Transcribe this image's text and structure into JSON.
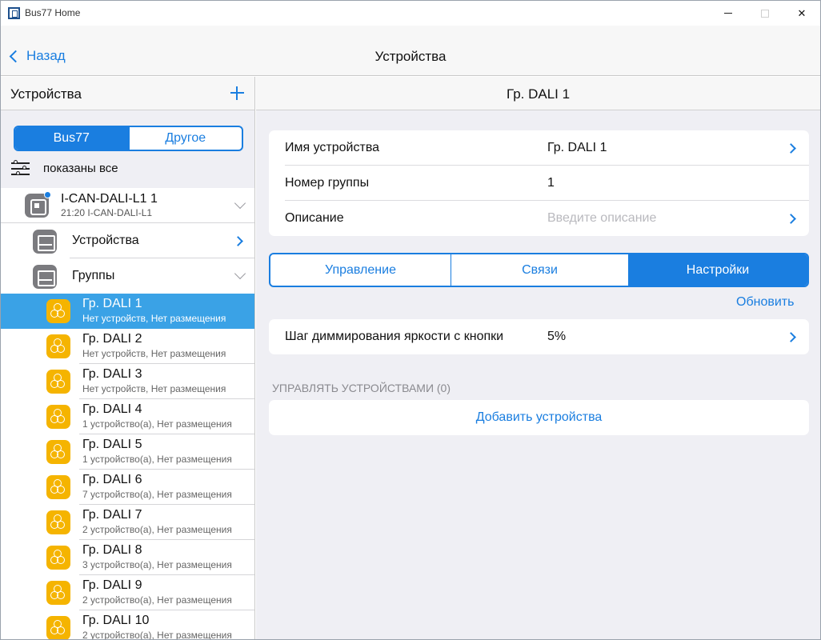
{
  "window": {
    "title": "Bus77 Home"
  },
  "nav": {
    "back_label": "Назад",
    "title": "Устройства"
  },
  "left": {
    "header_title": "Устройства",
    "source_tabs": [
      "Bus77",
      "Другое"
    ],
    "filter_label": "показаны все",
    "controller": {
      "title": "I-CAN-DALI-L1 1",
      "subtitle": "21:20 I-CAN-DALI-L1"
    },
    "folders": [
      {
        "label": "Устройства"
      },
      {
        "label": "Группы"
      }
    ],
    "groups": [
      {
        "title": "Гр. DALI 1",
        "subtitle": "Нет устройств, Нет размещения"
      },
      {
        "title": "Гр. DALI 2",
        "subtitle": "Нет устройств, Нет размещения"
      },
      {
        "title": "Гр. DALI 3",
        "subtitle": "Нет устройств, Нет размещения"
      },
      {
        "title": "Гр. DALI 4",
        "subtitle": "1 устройство(а), Нет размещения"
      },
      {
        "title": "Гр. DALI 5",
        "subtitle": "1 устройство(а), Нет размещения"
      },
      {
        "title": "Гр. DALI 6",
        "subtitle": "7 устройство(а), Нет размещения"
      },
      {
        "title": "Гр. DALI 7",
        "subtitle": "2 устройство(а), Нет размещения"
      },
      {
        "title": "Гр. DALI 8",
        "subtitle": "3 устройство(а), Нет размещения"
      },
      {
        "title": "Гр. DALI 9",
        "subtitle": "2 устройство(а), Нет размещения"
      },
      {
        "title": "Гр. DALI 10",
        "subtitle": "2 устройство(а), Нет размещения"
      }
    ]
  },
  "detail": {
    "title": "Гр. DALI 1",
    "fields": {
      "name_label": "Имя устройства",
      "name_value": "Гр. DALI 1",
      "group_label": "Номер группы",
      "group_value": "1",
      "desc_label": "Описание",
      "desc_placeholder": "Введите описание"
    },
    "tabs": [
      "Управление",
      "Связи",
      "Настройки"
    ],
    "refresh_label": "Обновить",
    "dimming_label": "Шаг диммирования яркости с кнопки",
    "dimming_value": "5%",
    "section_label": "УПРАВЛЯТЬ УСТРОЙСТВАМИ (0)",
    "add_devices_label": "Добавить устройства"
  },
  "colors": {
    "accent": "#1a7ee0",
    "selected_row": "#3aa2e6",
    "group_icon": "#f5b400",
    "device_icon": "#7b7b7f"
  }
}
